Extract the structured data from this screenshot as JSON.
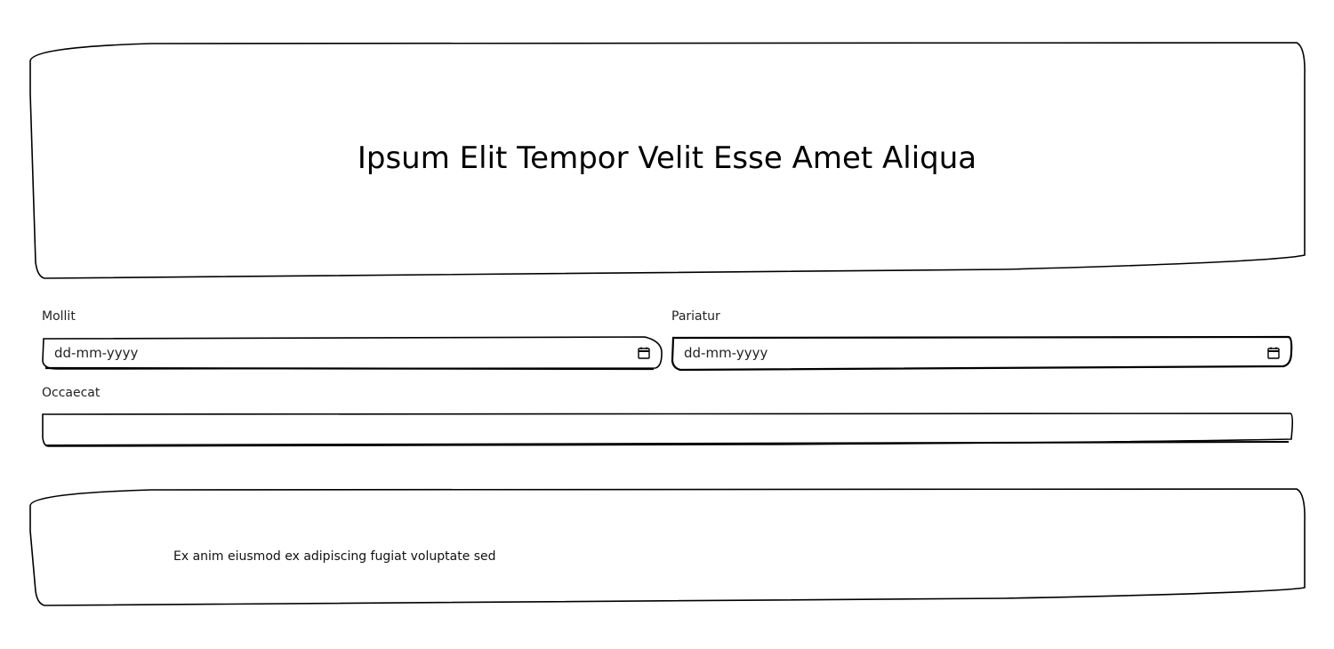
{
  "header": {
    "title": "Ipsum Elit Tempor Velit Esse Amet Aliqua"
  },
  "form": {
    "fields": [
      {
        "label": "Mollit",
        "type": "date",
        "placeholder": "dd-mm-yyyy"
      },
      {
        "label": "Pariatur",
        "type": "date",
        "placeholder": "dd-mm-yyyy"
      },
      {
        "label": "Occaecat",
        "type": "text",
        "value": ""
      }
    ]
  },
  "footer": {
    "text": "Ex anim eiusmod ex adipiscing fugiat voluptate sed"
  },
  "icons": {
    "date_picker": "calendar-icon"
  },
  "colors": {
    "stroke": "#000000",
    "background": "#ffffff"
  }
}
